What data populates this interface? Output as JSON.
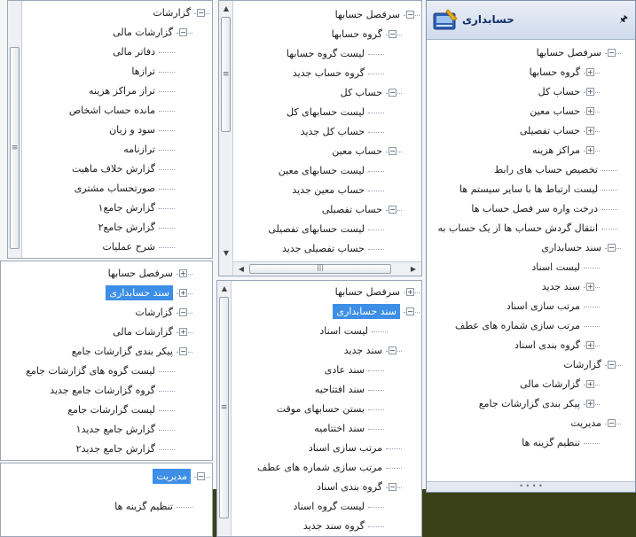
{
  "main_panel": {
    "title": "حسابداری",
    "pin_icon": "pin-icon",
    "tree": [
      {
        "label": "سرفصل حسابها",
        "exp": "-"
      },
      {
        "label": "گروه حسابها",
        "exp": "+"
      },
      {
        "label": "حساب کل",
        "exp": "+"
      },
      {
        "label": "حساب معین",
        "exp": "+"
      },
      {
        "label": "حساب تفصیلی",
        "exp": "+"
      },
      {
        "label": "مراکز هزینه",
        "exp": "+"
      },
      {
        "label": "تخصیص حساب های رابط"
      },
      {
        "label": "لیست ارتباط ها با سایر سیستم ها"
      },
      {
        "label": "درخت واره سر فصل حساب ها"
      },
      {
        "label": "انتقال گردش حساب ها از یک حساب به"
      },
      {
        "label": "سند حسابداری",
        "exp": "-"
      },
      {
        "label": "لیست اسناد"
      },
      {
        "label": "سند جدید",
        "exp": "+"
      },
      {
        "label": "مرتب سازی اسناد"
      },
      {
        "label": "مرتب سازی شماره های عطف"
      },
      {
        "label": "گروه بندی اسناد",
        "exp": "+"
      },
      {
        "label": "گزارشات",
        "exp": "-"
      },
      {
        "label": "گزارشات مالی",
        "exp": "+"
      },
      {
        "label": "پیکر بندی گزارشات جامع",
        "exp": "+"
      },
      {
        "label": "مدیریت",
        "exp": "-"
      },
      {
        "label": "تنظیم گزینه ها"
      }
    ]
  },
  "panel_a": {
    "tree": [
      {
        "label": "سرفصل حسابها",
        "exp": "-"
      },
      {
        "label": "گروه حسابها",
        "exp": "-"
      },
      {
        "label": "لیست گروه حسابها"
      },
      {
        "label": "گروه حساب جدید"
      },
      {
        "label": "حساب کل",
        "exp": "-"
      },
      {
        "label": "لیست حسابهای کل"
      },
      {
        "label": "حساب کل جدید"
      },
      {
        "label": "حساب معین",
        "exp": "-"
      },
      {
        "label": "لیست حسابهای معین"
      },
      {
        "label": "حساب معین جدید"
      },
      {
        "label": "حساب تفصیلی",
        "exp": "-"
      },
      {
        "label": "لیست حسابهای تفصیلی"
      },
      {
        "label": "حساب تفصیلی جدید"
      }
    ]
  },
  "panel_b": {
    "tree": [
      {
        "label": "سرفصل حسابها",
        "exp": "+"
      },
      {
        "label": "سند حسابداری",
        "exp": "-",
        "selected": true
      },
      {
        "label": "لیست اسناد"
      },
      {
        "label": "سند جدید",
        "exp": "-"
      },
      {
        "label": "سند عادی"
      },
      {
        "label": "سند افتتاحیه"
      },
      {
        "label": "بستن حسابهای موقت"
      },
      {
        "label": "سند اختتامیه"
      },
      {
        "label": "مرتب سازی اسناد"
      },
      {
        "label": "مرتب سازی شماره های عطف"
      },
      {
        "label": "گروه بندی اسناد",
        "exp": "-"
      },
      {
        "label": "لیست گروه اسناد"
      },
      {
        "label": "گروه سند جدید"
      }
    ]
  },
  "panel_c": {
    "tree": [
      {
        "label": "گزارشات",
        "exp": "-"
      },
      {
        "label": "گزارشات مالی",
        "exp": "-"
      },
      {
        "label": "دفاتر مالی"
      },
      {
        "label": "ترازها"
      },
      {
        "label": "تراز مراکز هزینه"
      },
      {
        "label": "مانده حساب اشخاص"
      },
      {
        "label": "سود و زیان"
      },
      {
        "label": "ترازنامه"
      },
      {
        "label": "گزارش خلاف ماهیت"
      },
      {
        "label": "صورتحساب مشتری"
      },
      {
        "label": "گزارش جامع۱"
      },
      {
        "label": "گزارش جامع۲"
      },
      {
        "label": "شرح عملیات"
      }
    ]
  },
  "panel_d": {
    "tree": [
      {
        "label": "سرفصل حسابها",
        "exp": "+"
      },
      {
        "label": "سند حسابداری",
        "exp": "+",
        "selected": true
      },
      {
        "label": "گزارشات",
        "exp": "-"
      },
      {
        "label": "گزارشات مالی",
        "exp": "+"
      },
      {
        "label": "پیکر بندی گزارشات جامع",
        "exp": "-"
      },
      {
        "label": "لیست گروه های گزارشات جامع"
      },
      {
        "label": "گروه گزارشات جامع جدید"
      },
      {
        "label": "لیست گزارشات جامع"
      },
      {
        "label": "گزارش جامع جدید۱"
      },
      {
        "label": "گزارش جامع جدید۲"
      }
    ]
  },
  "panel_e": {
    "tree": [
      {
        "label": "مدیریت",
        "exp": "-",
        "selected": true
      },
      {
        "label": "تنظیم گزینه ها"
      }
    ]
  },
  "colors": {
    "selection": "#3d8ee6",
    "taskbar": "#3a4117"
  }
}
